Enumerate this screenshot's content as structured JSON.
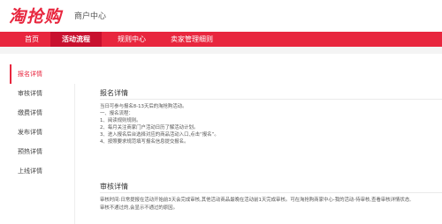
{
  "header": {
    "logo_text": "淘抢购",
    "subtitle": "商户中心"
  },
  "nav": {
    "items": [
      {
        "label": "首页"
      },
      {
        "label": "活动流程"
      },
      {
        "label": "规则中心"
      },
      {
        "label": "卖家管理细则"
      }
    ]
  },
  "sidebar": {
    "items": [
      {
        "label": "报名详情"
      },
      {
        "label": "审核详情"
      },
      {
        "label": "缴费详情"
      },
      {
        "label": "发布详情"
      },
      {
        "label": "预热详情"
      },
      {
        "label": "上线详情"
      }
    ]
  },
  "content": {
    "signup": {
      "title": "报名详情",
      "lines": [
        "当日可参与报名8-13天后的淘抢购活动。",
        "一、报名流程：",
        "1、阅读规则规则。",
        "2、每月关注商家门户活动日历了解活动计划。",
        "3、进入报名后台选择对应的商品活动入口,点击“报名”。",
        "4、按照要求规范填写报名信息提交报名。"
      ]
    },
    "review": {
      "title": "审核详情",
      "lines": [
        "审核时间:日常提报在活动开始前3天会完成审核,其他活动商品最晚在活动前1天完成审核。可在淘抢购商家中心-我的活动-待审核,查看审核详情状态,",
        "审核不通过的,会显示不通过的原因。"
      ]
    }
  }
}
